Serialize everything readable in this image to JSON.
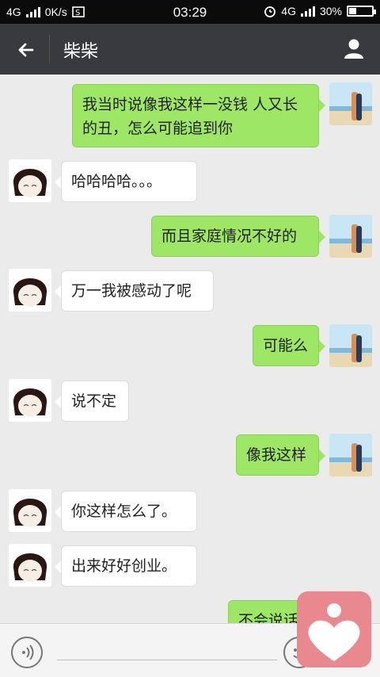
{
  "status_bar": {
    "network_left": "4G",
    "speed": "0K/s",
    "time": "03:29",
    "network_right": "4G",
    "battery": "30%",
    "battery_level": 0.3
  },
  "header": {
    "title": "柴柴"
  },
  "messages": [
    {
      "side": "right",
      "text": "我当时说像我这样一没钱  人又长的丑，怎么可能追到你"
    },
    {
      "side": "left",
      "text": "哈哈哈哈。。。"
    },
    {
      "side": "right",
      "text": "而且家庭情况不好的"
    },
    {
      "side": "left",
      "text": "万一我被感动了呢"
    },
    {
      "side": "right",
      "text": "可能么"
    },
    {
      "side": "left",
      "text": "说不定"
    },
    {
      "side": "right",
      "text": "像我这样"
    },
    {
      "side": "left",
      "text": "你这样怎么了。"
    },
    {
      "side": "left",
      "text": "出来好好创业。"
    },
    {
      "side": "right",
      "text": "不会说话"
    }
  ],
  "colors": {
    "titlebar": "#393a3f",
    "bubble_right": "#9ee665",
    "bubble_left": "#ffffff",
    "chat_background": "#ebebeb",
    "watermark": "#e9888e"
  },
  "icons": {
    "back": "arrow-left-icon",
    "profile": "person-icon",
    "voice": "voice-icon",
    "emoji": "emoji-icon",
    "watermark": "heart-logo"
  }
}
